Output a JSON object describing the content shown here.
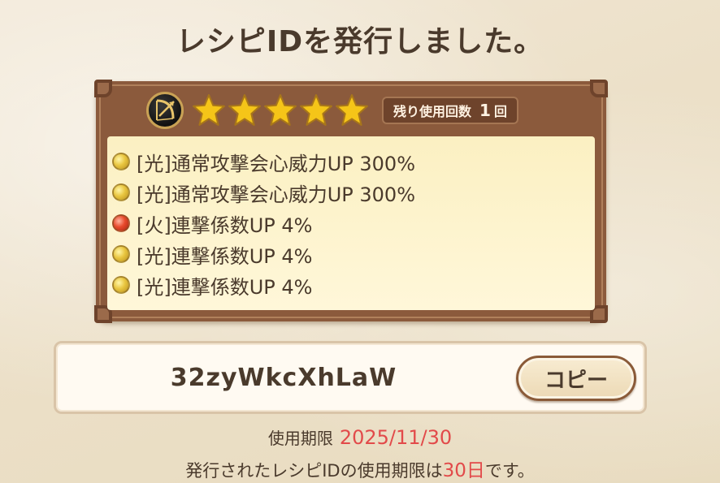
{
  "dialog": {
    "title": "レシピIDを発行しました。"
  },
  "recipe": {
    "weapon_icon": "bow-icon",
    "rarity_stars": 5,
    "uses_label": "残り使用回数",
    "uses_count": "1",
    "uses_unit": "回",
    "effects": [
      {
        "element": "light",
        "text": "[光]通常攻撃会心威力UP 300%"
      },
      {
        "element": "light",
        "text": "[光]通常攻撃会心威力UP 300%"
      },
      {
        "element": "fire",
        "text": "[火]連撃係数UP 4%"
      },
      {
        "element": "light",
        "text": "[光]連撃係数UP 4%"
      },
      {
        "element": "light",
        "text": "[光]連撃係数UP 4%"
      }
    ]
  },
  "id_box": {
    "recipe_id": "32zyWkcXhLaW",
    "copy_label": "コピー"
  },
  "expiry": {
    "label": "使用期限",
    "date": "2025/11/30",
    "note_prefix": "発行されたレシピIDの使用期限は",
    "note_days": "30日",
    "note_suffix": "です。"
  },
  "colors": {
    "accent_red": "#e24a4a",
    "text_brown": "#4a3a2c",
    "frame_brown": "#8b5a3c",
    "star_gold": "#f5c518"
  }
}
